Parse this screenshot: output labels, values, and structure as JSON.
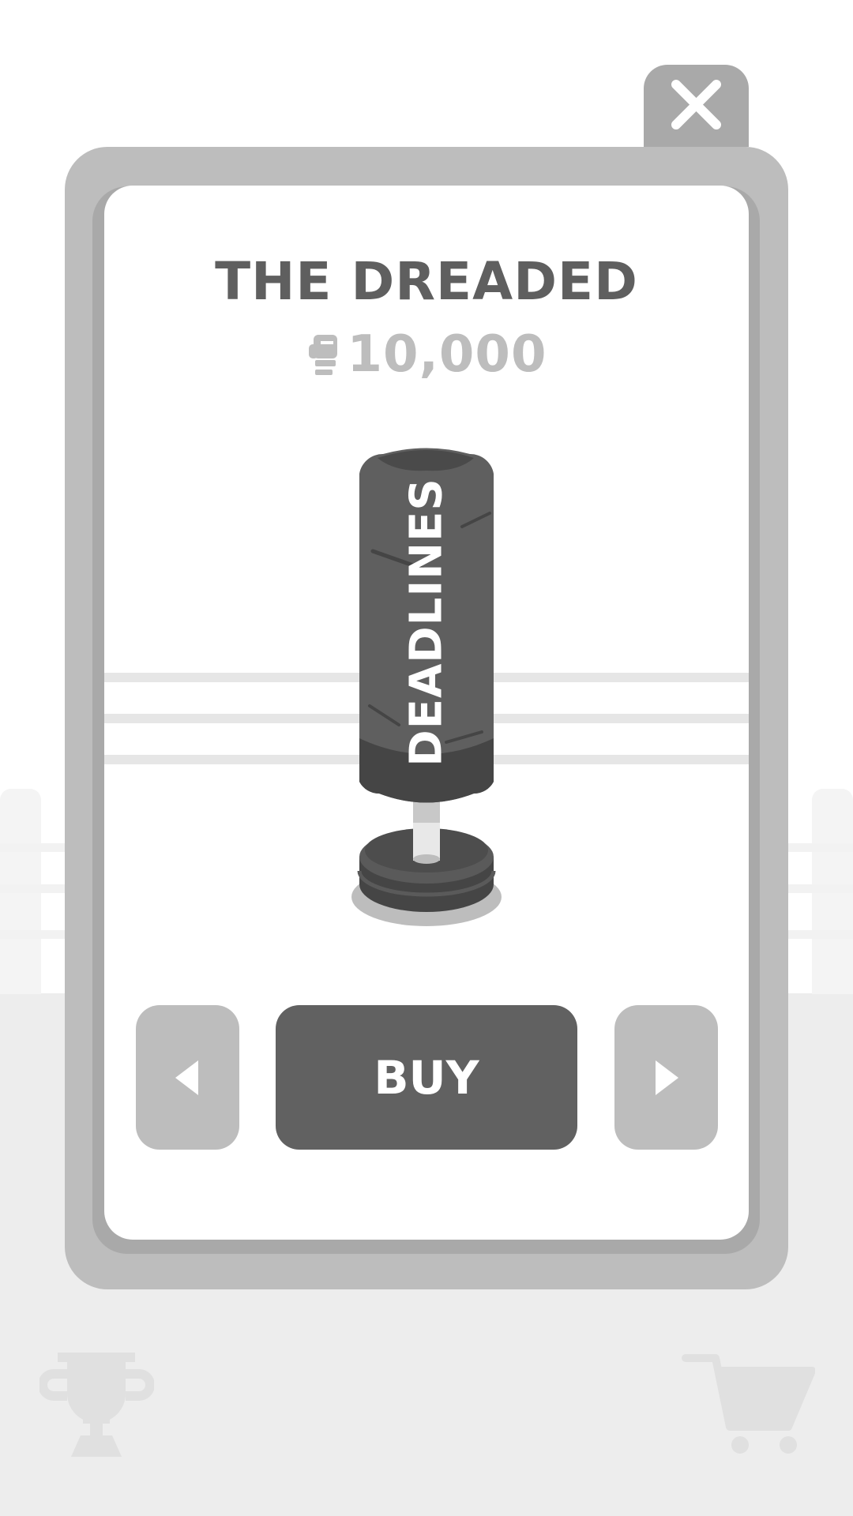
{
  "item": {
    "title": "THE DREADED",
    "price": "10,000",
    "currency_icon": "boxing-glove-icon",
    "bag_label": "DEADLINES"
  },
  "buttons": {
    "buy_label": "BUY",
    "close_icon": "close-icon",
    "prev_icon": "triangle-left-icon",
    "next_icon": "triangle-right-icon"
  },
  "bottom_bar": {
    "left_icon": "trophy-icon",
    "right_icon": "cart-icon"
  },
  "colors": {
    "frame": "#bdbdbd",
    "frame_dark": "#a9a9a9",
    "title_text": "#5f5f5f",
    "price_text": "#bdbdbd",
    "buy_button": "#616161",
    "nav_button": "#bdbdbd",
    "bag": "#5f5f5f",
    "bag_dark": "#454545"
  }
}
